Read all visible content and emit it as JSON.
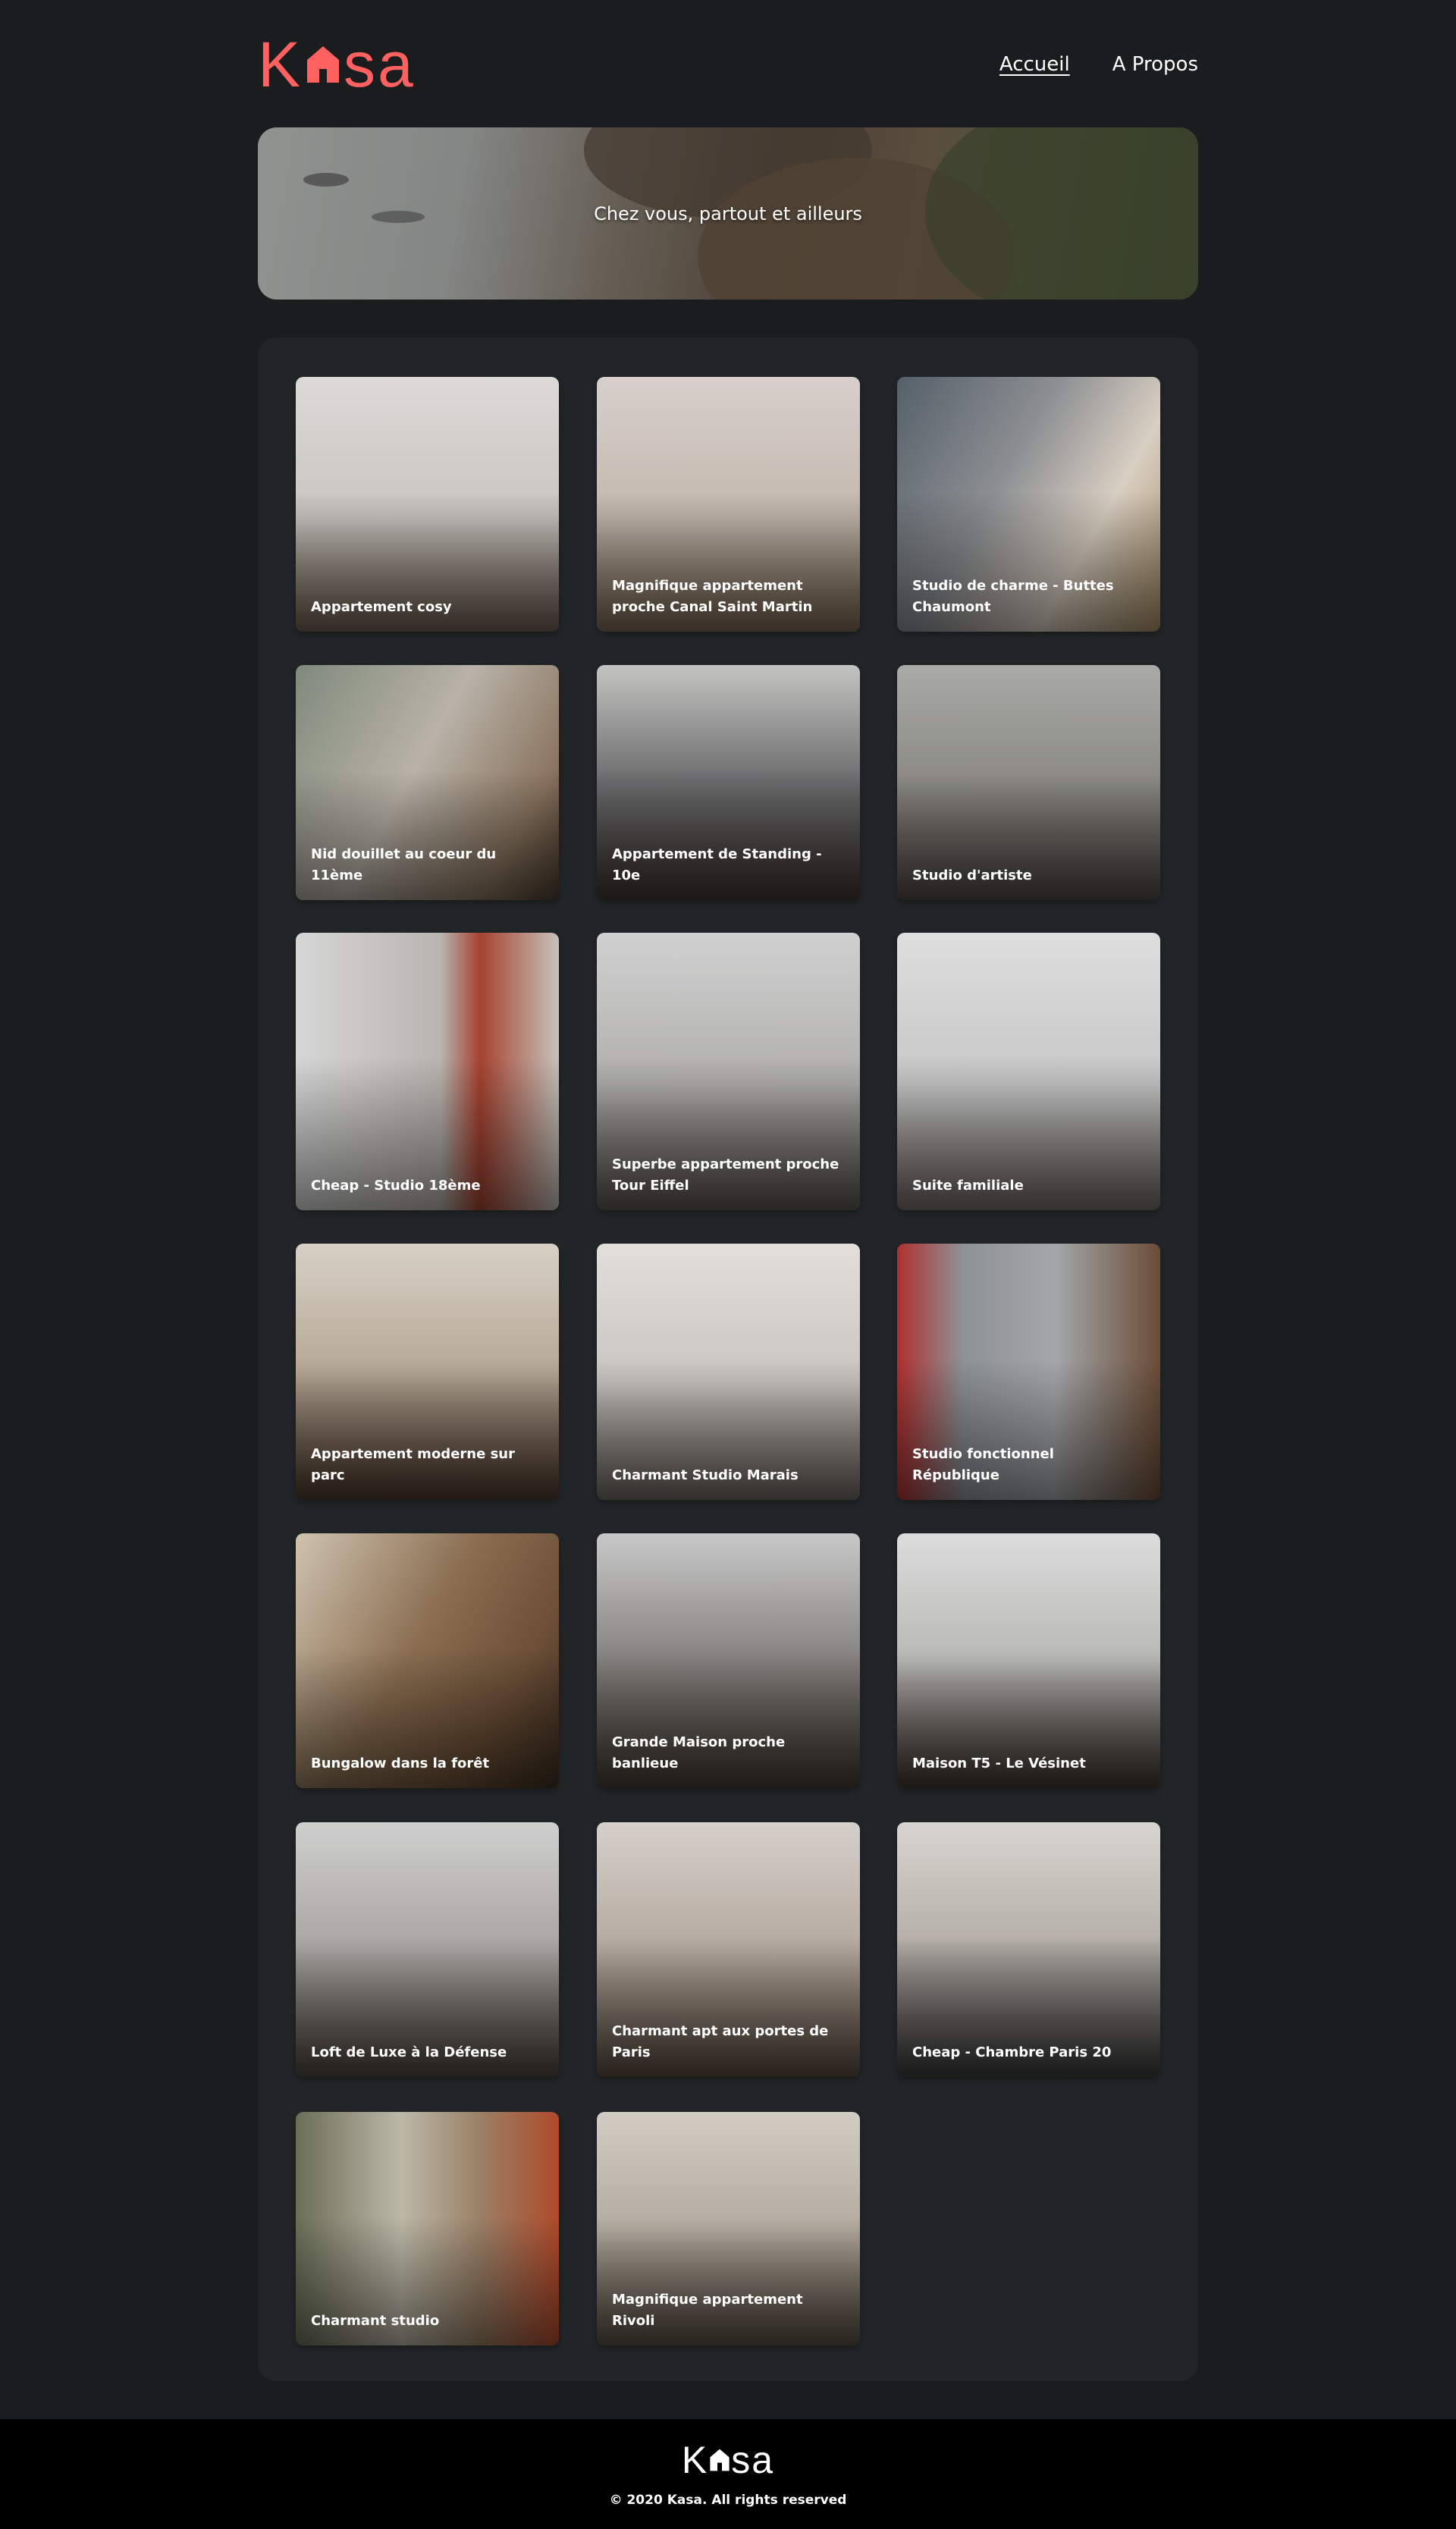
{
  "brand": {
    "logo_left": "K",
    "logo_right": "sa",
    "logo_color": "#FF6060"
  },
  "nav": {
    "home": "Accueil",
    "about": "A Propos"
  },
  "banner": {
    "title": "Chez vous, partout et ailleurs"
  },
  "listings": [
    {
      "title": "Appartement cosy"
    },
    {
      "title": "Magnifique appartement proche Canal Saint Martin"
    },
    {
      "title": "Studio de charme - Buttes Chaumont"
    },
    {
      "title": "Nid douillet au coeur du 11ème"
    },
    {
      "title": "Appartement de Standing - 10e"
    },
    {
      "title": "Studio d'artiste"
    },
    {
      "title": "Cheap - Studio 18ème"
    },
    {
      "title": "Superbe appartement proche Tour Eiffel"
    },
    {
      "title": "Suite familiale"
    },
    {
      "title": "Appartement moderne sur parc"
    },
    {
      "title": "Charmant Studio Marais"
    },
    {
      "title": "Studio fonctionnel République"
    },
    {
      "title": "Bungalow dans la forêt"
    },
    {
      "title": "Grande Maison proche banlieue"
    },
    {
      "title": "Maison T5 - Le Vésinet"
    },
    {
      "title": "Loft de Luxe à la Défense"
    },
    {
      "title": "Charmant apt aux portes de Paris"
    },
    {
      "title": "Cheap - Chambre Paris 20"
    },
    {
      "title": "Charmant studio"
    },
    {
      "title": "Magnifique appartement Rivoli"
    }
  ],
  "footer": {
    "logo_left": "K",
    "logo_right": "sa",
    "copyright": "© 2020 Kasa. All rights reserved"
  }
}
